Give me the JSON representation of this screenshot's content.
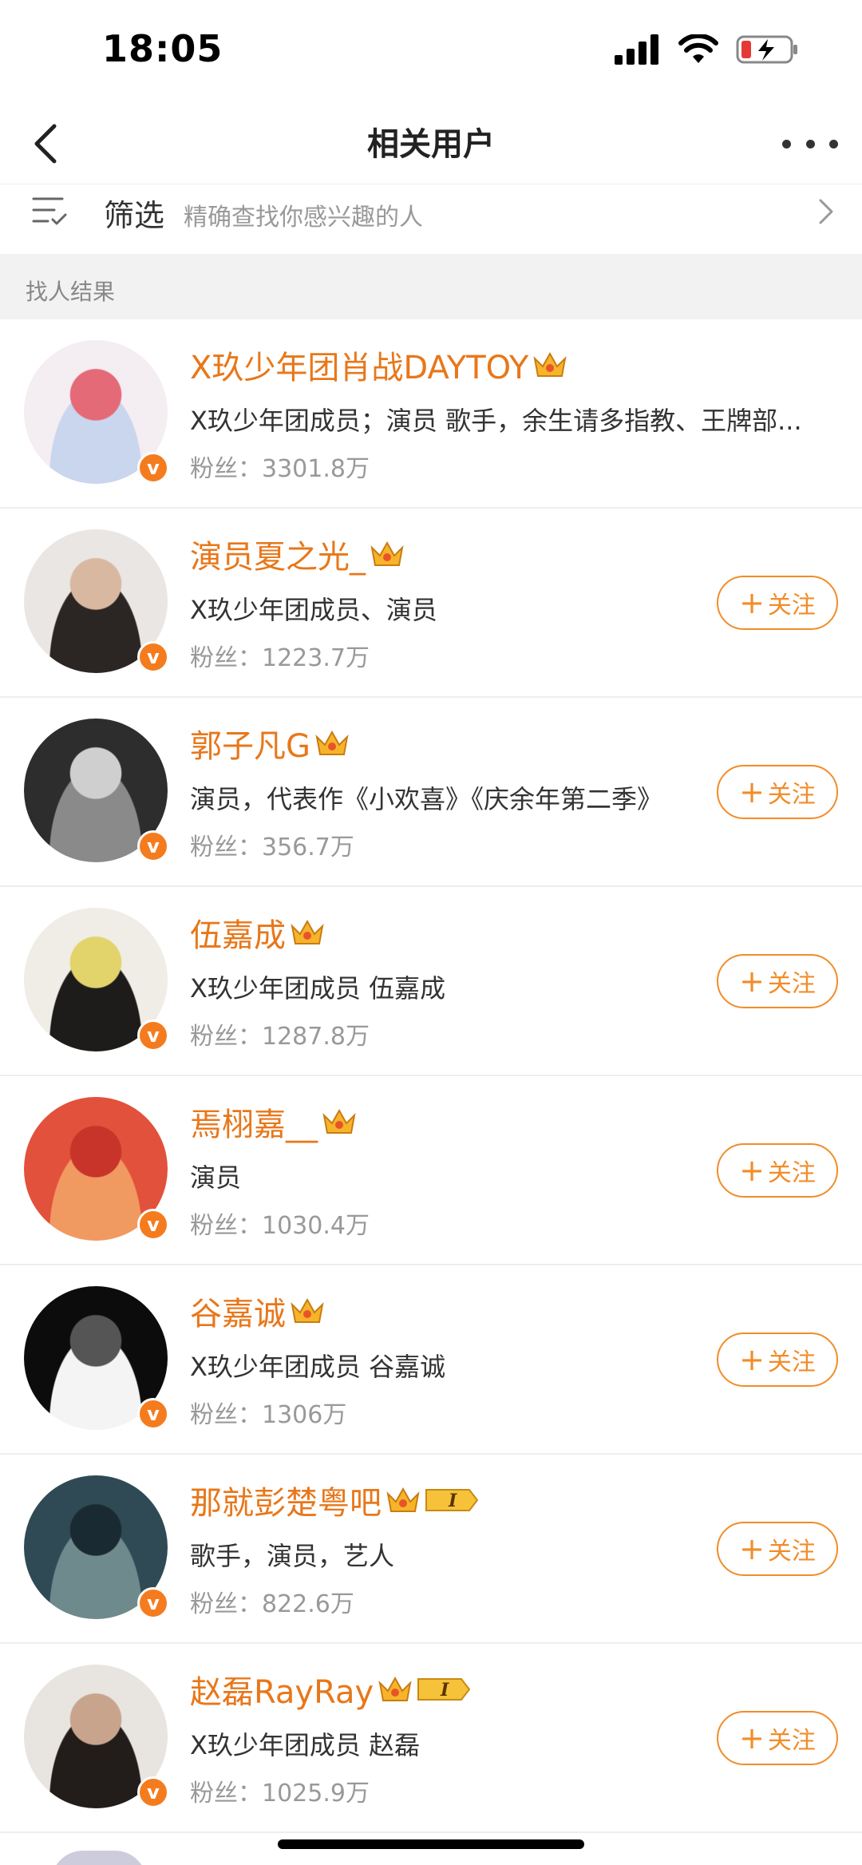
{
  "status_bar": {
    "time": "18:05"
  },
  "nav": {
    "title": "相关用户"
  },
  "filter": {
    "label": "筛选",
    "description": "精确查找你感兴趣的人"
  },
  "section": {
    "title": "找人结果"
  },
  "follow_label": "关注",
  "users": [
    {
      "name": "X玖少年团肖战DAYTOY",
      "desc": "X玖少年团成员；演员 歌手，余生请多指教、王牌部...",
      "fans": "粉丝：3301.8万",
      "badge": "crown",
      "show_follow": false,
      "avatar_colors": [
        "#f4eef2",
        "#c9d6ee",
        "#e46a78"
      ]
    },
    {
      "name": "演员夏之光_",
      "desc": "X玖少年团成员、演员",
      "fans": "粉丝：1223.7万",
      "badge": "crown",
      "show_follow": true,
      "avatar_colors": [
        "#e9e6e3",
        "#2b2624",
        "#d8b8a1"
      ]
    },
    {
      "name": "郭子凡G",
      "desc": "演员，代表作《小欢喜》《庆余年第二季》",
      "fans": "粉丝：356.7万",
      "badge": "crown",
      "show_follow": true,
      "avatar_colors": [
        "#2d2d2d",
        "#8a8a8a",
        "#cfcfcf"
      ]
    },
    {
      "name": "伍嘉成",
      "desc": "X玖少年团成员 伍嘉成",
      "fans": "粉丝：1287.8万",
      "badge": "crown",
      "show_follow": true,
      "avatar_colors": [
        "#f0ece6",
        "#1e1c1b",
        "#e2d36a"
      ]
    },
    {
      "name": "焉栩嘉__",
      "desc": "演员",
      "fans": "粉丝：1030.4万",
      "badge": "crown",
      "show_follow": true,
      "avatar_colors": [
        "#e2513b",
        "#f09a62",
        "#c8342a"
      ]
    },
    {
      "name": "谷嘉诚",
      "desc": "X玖少年团成员 谷嘉诚",
      "fans": "粉丝：1306万",
      "badge": "crown",
      "show_follow": true,
      "avatar_colors": [
        "#0c0c0c",
        "#f4f4f4",
        "#555555"
      ]
    },
    {
      "name": "那就彭楚粤吧",
      "desc": "歌手，演员，艺人",
      "fans": "粉丝：822.6万",
      "badge": "level",
      "level_text": "I",
      "show_follow": true,
      "avatar_colors": [
        "#2f4a55",
        "#6f8a8d",
        "#1a2a32"
      ]
    },
    {
      "name": "赵磊RayRay",
      "desc": "X玖少年团成员 赵磊",
      "fans": "粉丝：1025.9万",
      "badge": "level",
      "level_text": "I",
      "show_follow": true,
      "avatar_colors": [
        "#e8e5e1",
        "#221c1a",
        "#c9a48c"
      ]
    }
  ],
  "colors": {
    "accent": "#e8771a",
    "follow": "#f28c28",
    "verified": "#f47c1f"
  }
}
